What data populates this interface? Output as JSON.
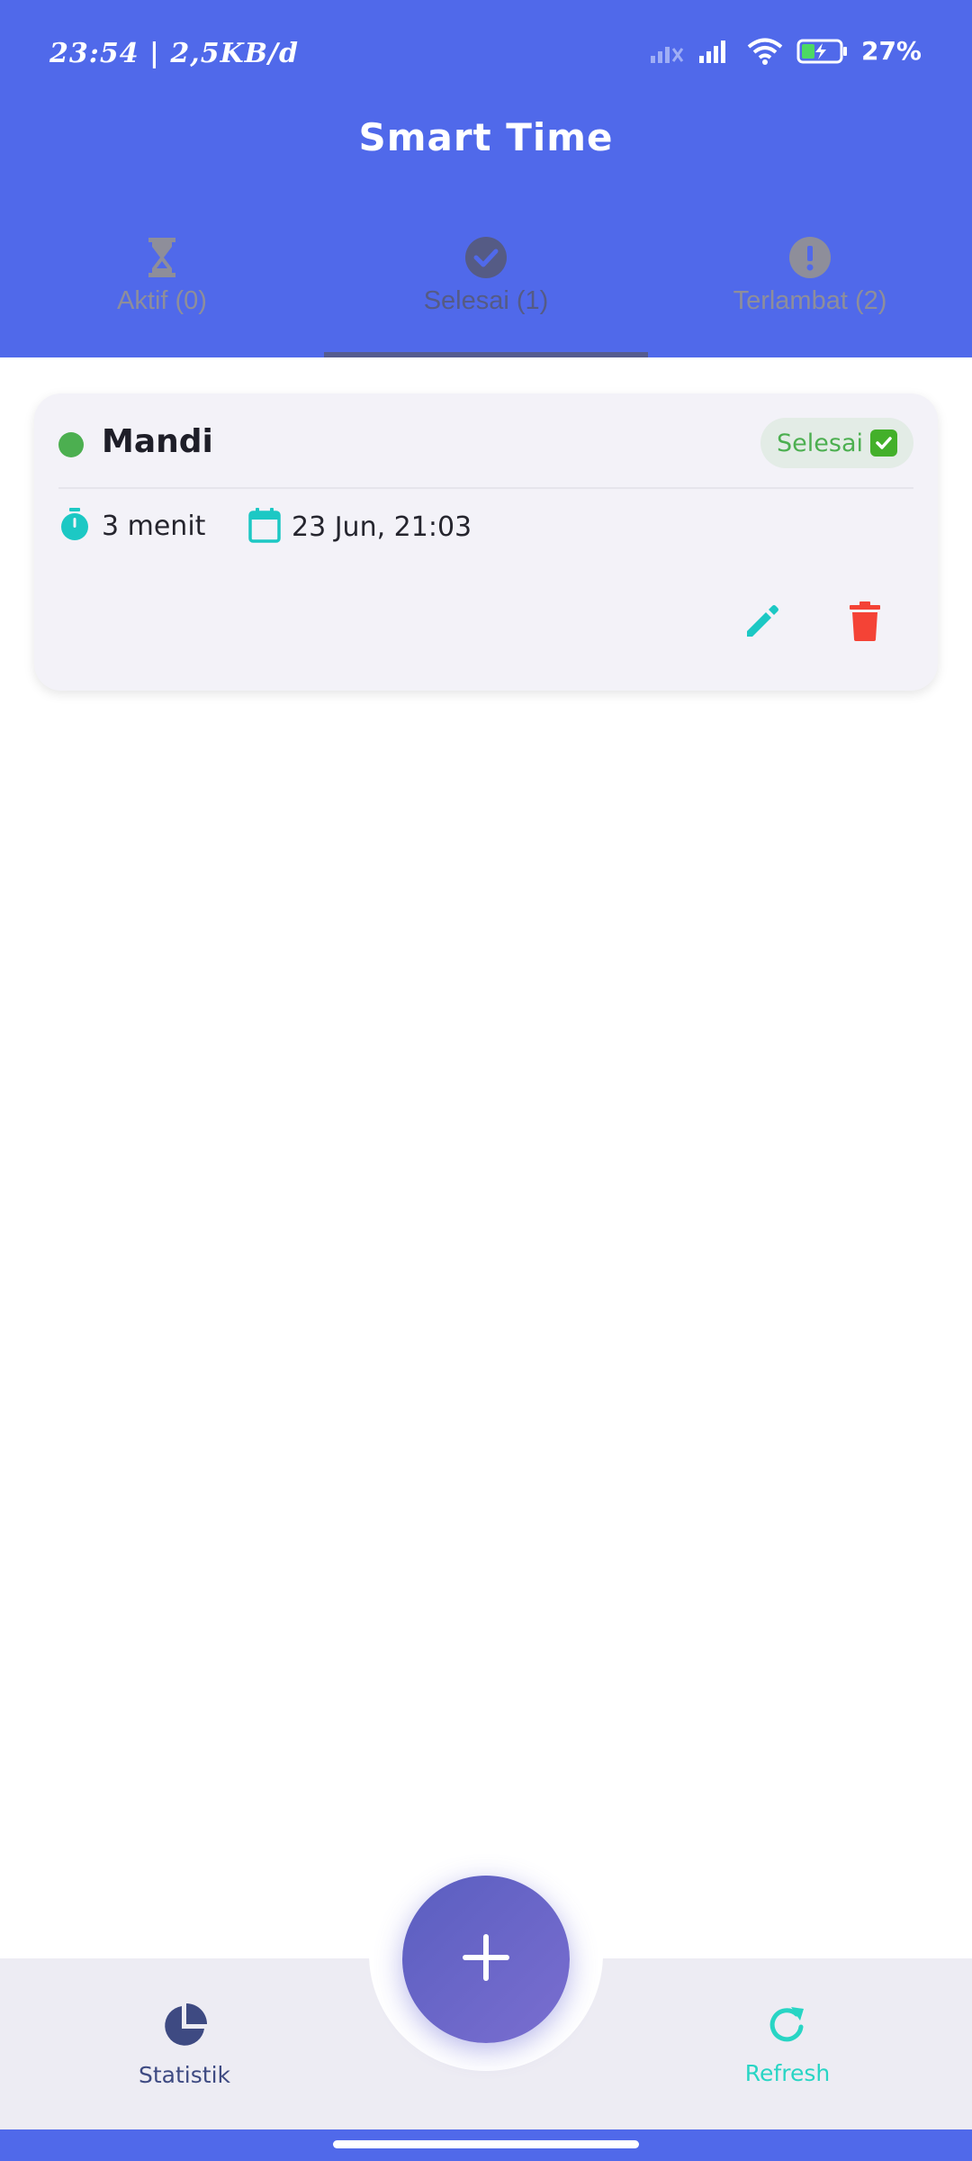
{
  "status_bar": {
    "time_speed": "23:54 | 2,5KB/d",
    "battery": "27%",
    "icons": [
      "signal-off-icon",
      "signal-icon",
      "wifi-icon",
      "battery-charging-icon"
    ]
  },
  "app": {
    "title": "Smart Time",
    "accent": "#5069EA"
  },
  "tabs": [
    {
      "label": "Aktif (0)",
      "icon": "hourglass-icon",
      "active": false
    },
    {
      "label": "Selesai (1)",
      "icon": "check-circle-icon",
      "active": true
    },
    {
      "label": "Terlambat (2)",
      "icon": "alert-circle-icon",
      "active": false
    }
  ],
  "tasks": [
    {
      "title": "Mandi",
      "status": "Selesai ✅",
      "status_label": "Selesai",
      "status_color": "#4CAF50",
      "duration": "3 menit",
      "datetime": "23 Jun, 21:03",
      "actions": [
        "edit-icon",
        "delete-icon"
      ]
    }
  ],
  "bottom_nav": {
    "left_label": "Statistik",
    "right_label": "Refresh",
    "fab_icon": "plus-icon"
  }
}
